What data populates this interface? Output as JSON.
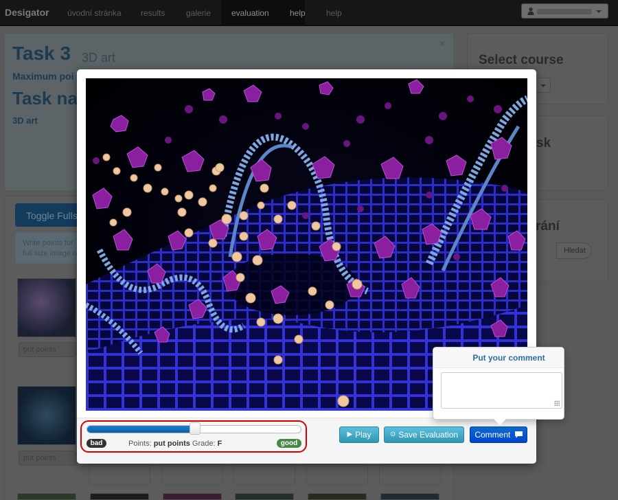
{
  "navbar": {
    "brand": "Desigator",
    "items": [
      {
        "label": "úvodní stránka"
      },
      {
        "label": "results"
      },
      {
        "label": "galerie"
      },
      {
        "label": "evaluation"
      },
      {
        "label": "help"
      },
      {
        "label": "help"
      }
    ]
  },
  "background": {
    "task_title": "Task 3",
    "task_subtitle": "3D art",
    "max_points_label": "Maximum poi",
    "task_name": "Task na",
    "task_category": "3D art",
    "toggle_fullscreen": "Toggle Fulls",
    "info_line1": "Write points for",
    "info_line2": "full size image o",
    "thumb_input_placeholder": "put points",
    "sidebar": {
      "select_course_title": "Select course",
      "task_title": "sk",
      "search_title": "rání",
      "search_button": "Hledat"
    }
  },
  "modal": {
    "evaluation": {
      "bad_label": "bad",
      "good_label": "good",
      "points_prefix": "Points:",
      "points_value": "put points",
      "grade_prefix": "Grade:",
      "grade_value": "F",
      "slider_fraction": 0.5
    },
    "buttons": {
      "play": "Play",
      "save": "Save Evaluation",
      "comment": "Comment"
    },
    "comment_popover": {
      "title": "Put your comment",
      "value": ""
    }
  },
  "colors": {
    "primary": "#0044cc",
    "info": "#2f96b4",
    "success": "#468847",
    "highlight_outline": "#d40000"
  }
}
